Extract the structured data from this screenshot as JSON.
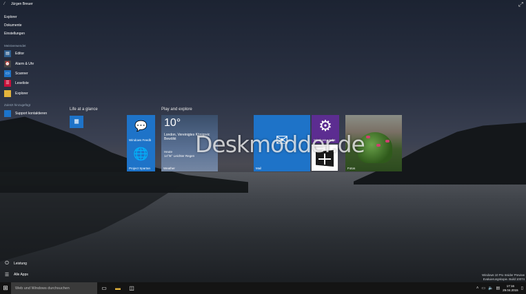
{
  "user": {
    "name": "Jürgen Breuer",
    "icon": "user-icon"
  },
  "nav_links": [
    "Explorer",
    "Dokumente",
    "Einstellungen"
  ],
  "most_used": {
    "title": "Meistverwendet",
    "items": [
      {
        "label": "Editor",
        "icon": "notepad-icon",
        "color": "#2f5f8f"
      },
      {
        "label": "Alarm & Uhr",
        "icon": "alarm-icon",
        "color": "#444444"
      },
      {
        "label": "Scanner",
        "icon": "scanner-icon",
        "color": "#1e73c8"
      },
      {
        "label": "Leseliste",
        "icon": "reading-list-icon",
        "color": "#c8103a"
      },
      {
        "label": "Explorer",
        "icon": "folder-icon",
        "color": "#e4b43c"
      }
    ]
  },
  "recent": {
    "title": "Zuletzt hinzugefügt",
    "items": [
      {
        "label": "Support kontaktieren",
        "icon": "support-icon",
        "color": "#1e73c8"
      }
    ]
  },
  "bottom": {
    "power_label": "Leistung",
    "all_apps_label": "Alle Apps"
  },
  "groups": {
    "life": {
      "title": "Life at a glance"
    },
    "play": {
      "title": "Play and explore"
    }
  },
  "tiles": {
    "feedback": {
      "label": "Windows Feedb",
      "icon": "feedback-icon"
    },
    "spartan": {
      "label": "Project Spartan",
      "icon": "globe-icon"
    },
    "weather": {
      "label": "Weather",
      "temp": "10°",
      "city": "London, Vereinigtes Königreic",
      "cond": "Bewölkt",
      "today_label": "Heute",
      "today_val": "14°/6° Leichter Regen"
    },
    "mail": {
      "label": "Mail",
      "icon": "mail-icon"
    },
    "update": {
      "label": "Windows Updat",
      "icon": "gear-icon"
    },
    "store": {
      "icon": "store-icon"
    },
    "photos": {
      "label": "Fotos"
    }
  },
  "watermark": "Deskmodder.de",
  "build_info": {
    "line1": "Windows 10 Pro Insider Preview",
    "line2": "Evaluierungskopie. Build 10074"
  },
  "taskbar": {
    "search_placeholder": "Web und Windows durchsuchen",
    "time": "17:16",
    "date": "29.04.2015"
  },
  "colors": {
    "accent": "#1e73c8",
    "purple": "#5c2d91",
    "taskbar": "#141414"
  }
}
